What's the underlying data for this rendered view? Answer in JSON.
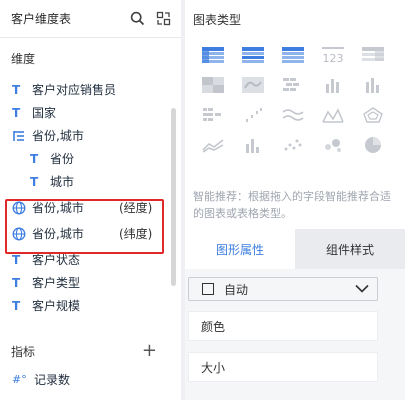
{
  "left": {
    "title": "客户维度表",
    "dimension_header": "维度",
    "fields": [
      {
        "kind": "text",
        "label": "客户对应销售员"
      },
      {
        "kind": "text",
        "label": "国家"
      },
      {
        "kind": "hierarchy",
        "label": "省份,城市"
      },
      {
        "kind": "text",
        "label": "省份",
        "child": true
      },
      {
        "kind": "text",
        "label": "城市",
        "child": true
      },
      {
        "kind": "geo",
        "label": "省份,城市",
        "aux": "(经度)"
      },
      {
        "kind": "geo",
        "label": "省份,城市",
        "aux": "(纬度)"
      },
      {
        "kind": "text",
        "label": "客户状态"
      },
      {
        "kind": "text",
        "label": "客户类型"
      },
      {
        "kind": "text",
        "label": "客户规模"
      }
    ],
    "metric_header": "指标",
    "metric_plus": "+",
    "metrics": [
      {
        "label": "记录数",
        "tag": "#°"
      }
    ],
    "text_tag": "T"
  },
  "right": {
    "chart_type_title": "图表类型",
    "chart_icons": [
      "table-icon",
      "crosstable-icon",
      "grouptable-icon",
      "kpi-number-icon",
      "detail-table-icon",
      "heatmap-table-icon",
      "map-icon",
      "bar-ranking-icon",
      "column-chart-icon",
      "stacked-column-icon",
      "funnel-table-icon",
      "scatter-step-icon",
      "wave-line-icon",
      "area-line-icon",
      "radar-icon",
      "area-chart-icon",
      "bar-mix-icon",
      "scatter-icon",
      "bubble-icon",
      "pie-icon"
    ],
    "hint": "智能推荐：根据拖入的字段智能推荐合适的图表或表格类型。",
    "tabs": [
      "图形属性",
      "组件样式"
    ],
    "select_value": "自动",
    "props": [
      "颜色",
      "大小"
    ]
  },
  "colors": {
    "accent": "#3d7ee0",
    "highlight": "#e02a2a"
  }
}
